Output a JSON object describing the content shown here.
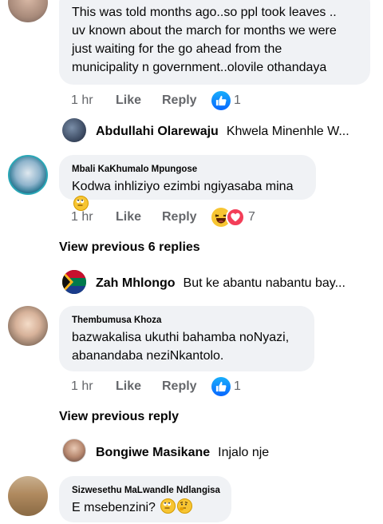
{
  "comments": [
    {
      "text_lines": [
        "This was told months ago..so ppl took leaves ..",
        "uv known about the march for months we were",
        "just waiting for the go ahead from the",
        "municipality n government..olovile othandaya"
      ],
      "time": "1 hr",
      "like": "Like",
      "reply": "Reply",
      "reaction_count": "1",
      "reaction_icon": "thumbs-up-icon"
    },
    {
      "author": "Mbali KaKhumalo Mpungose",
      "text": "Kodwa inhliziyo ezimbi ngiyasaba mina",
      "emoji": [
        "rolling-eyes-face-icon"
      ],
      "time": "1 hr",
      "like": "Like",
      "reply": "Reply",
      "reaction_count": "7",
      "reaction_icon": "haha-love-icon"
    },
    {
      "author": "Thembumusa Khoza",
      "text_lines": [
        "bazwakalisa ukuthi bahamba noNyazi,",
        "abanandaba neziNkantolo."
      ],
      "time": "1 hr",
      "like": "Like",
      "reply": "Reply",
      "reaction_count": "1",
      "reaction_icon": "thumbs-up-icon"
    },
    {
      "author": "Sizwesethu MaLwandle Ndlangisa",
      "text": "E msebenzini?",
      "emoji": [
        "rolling-eyes-face-icon",
        "thinking-face-icon"
      ]
    }
  ],
  "reply_previews": [
    {
      "name": "Abdullahi Olarewaju",
      "text": "Khwela Minenhle W..."
    },
    {
      "name": "Zah Mhlongo",
      "text": "But ke abantu nabantu bay..."
    },
    {
      "name": "Bongiwe Masikane",
      "text": "Injalo nje"
    }
  ],
  "view_previous": [
    "View previous 6 replies",
    "View previous reply"
  ],
  "colors": {
    "bubble_bg": "#f0f2f5",
    "meta_text": "#65676b",
    "like_blue": "#0866ff"
  }
}
